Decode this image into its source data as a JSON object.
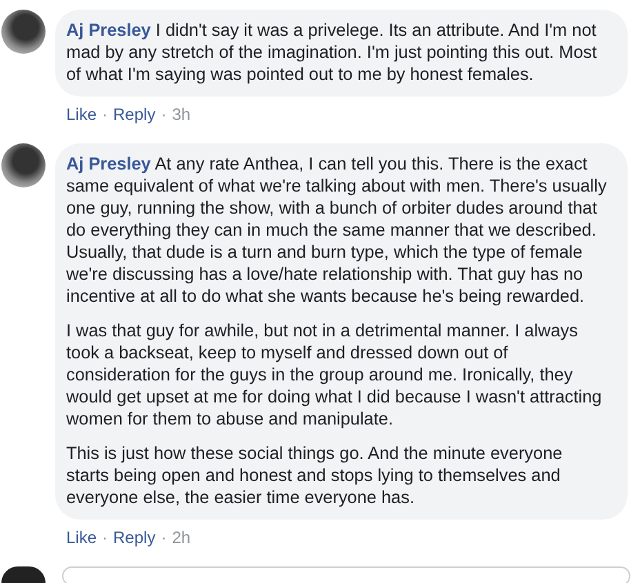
{
  "comments": [
    {
      "author": "Aj Presley",
      "paragraphs": [
        "I didn't say it was a privelege. Its an attribute. And I'm not mad by any stretch of the imagination. I'm just pointing this out. Most of what I'm saying was pointed out to me by honest females."
      ],
      "actions": [
        {
          "kind": "link",
          "label": "Like"
        },
        {
          "kind": "sep",
          "label": "·"
        },
        {
          "kind": "link",
          "label": "Reply"
        },
        {
          "kind": "sep",
          "label": "·"
        },
        {
          "kind": "time",
          "label": "3h"
        }
      ]
    },
    {
      "author": "Aj Presley",
      "paragraphs": [
        "At any rate Anthea, I can tell you this. There is the exact same equivalent of what we're talking about with men. There's usually one guy, running the show, with a bunch of orbiter dudes around that do everything they can in much the same manner that we described. Usually, that dude is a turn and burn type, which the type of female we're discussing has a love/hate relationship with. That guy has no incentive at all to do what she wants because he's being rewarded.",
        "I was that guy for awhile, but not in a detrimental manner. I always took a backseat, keep to myself and dressed down out of consideration for the guys in the group around me. Ironically, they would get upset at me for doing what I did because I wasn't attracting women for them to abuse and manipulate.",
        "This is just how these social things go. And the minute everyone starts being open and honest and stops lying to themselves and everyone else, the easier time everyone has."
      ],
      "actions": [
        {
          "kind": "link",
          "label": "Like"
        },
        {
          "kind": "sep",
          "label": "·"
        },
        {
          "kind": "link",
          "label": "Reply"
        },
        {
          "kind": "sep",
          "label": "·"
        },
        {
          "kind": "time",
          "label": "2h"
        }
      ]
    }
  ]
}
